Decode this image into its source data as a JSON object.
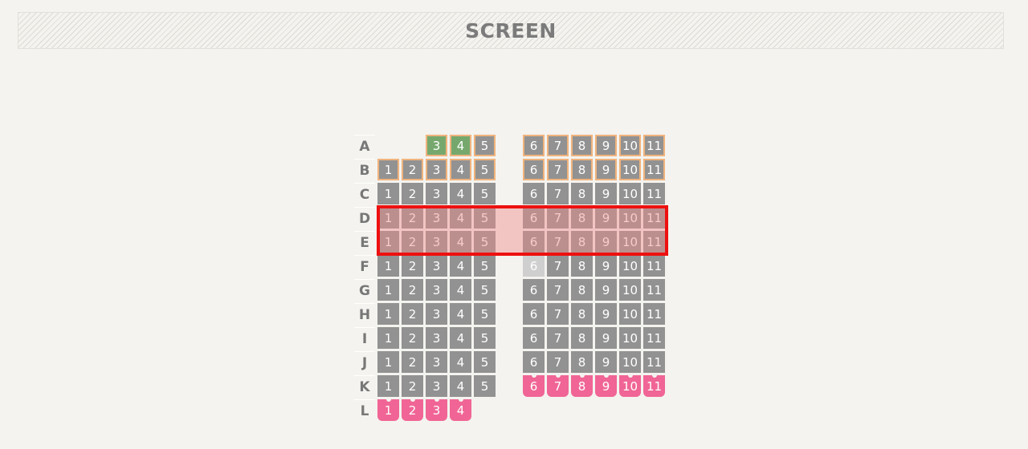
{
  "screen": {
    "label": "SCREEN"
  },
  "rows": [
    {
      "label": "A",
      "seats": [
        {
          "n": "3",
          "state": "green"
        },
        {
          "n": "4",
          "state": "green"
        },
        {
          "n": "5",
          "state": "orange"
        },
        {
          "n": "6",
          "state": "orange"
        },
        {
          "n": "7",
          "state": "orange"
        },
        {
          "n": "8",
          "state": "orange"
        },
        {
          "n": "9",
          "state": "orange"
        },
        {
          "n": "10",
          "state": "orange"
        },
        {
          "n": "11",
          "state": "orange"
        }
      ]
    },
    {
      "label": "B",
      "seats": [
        {
          "n": "1",
          "state": "orange"
        },
        {
          "n": "2",
          "state": "orange"
        },
        {
          "n": "3",
          "state": "orange"
        },
        {
          "n": "4",
          "state": "orange"
        },
        {
          "n": "5",
          "state": "orange"
        },
        {
          "n": "6",
          "state": "orange"
        },
        {
          "n": "7",
          "state": "orange"
        },
        {
          "n": "8",
          "state": "orange"
        },
        {
          "n": "9",
          "state": "orange"
        },
        {
          "n": "10",
          "state": "orange"
        },
        {
          "n": "11",
          "state": "orange"
        }
      ]
    },
    {
      "label": "C",
      "seats": [
        {
          "n": "1",
          "state": "regular"
        },
        {
          "n": "2",
          "state": "regular"
        },
        {
          "n": "3",
          "state": "regular"
        },
        {
          "n": "4",
          "state": "regular"
        },
        {
          "n": "5",
          "state": "regular"
        },
        {
          "n": "6",
          "state": "regular"
        },
        {
          "n": "7",
          "state": "regular"
        },
        {
          "n": "8",
          "state": "regular"
        },
        {
          "n": "9",
          "state": "regular"
        },
        {
          "n": "10",
          "state": "regular"
        },
        {
          "n": "11",
          "state": "regular"
        }
      ]
    },
    {
      "label": "D",
      "seats": [
        {
          "n": "1",
          "state": "regular"
        },
        {
          "n": "2",
          "state": "regular"
        },
        {
          "n": "3",
          "state": "regular"
        },
        {
          "n": "4",
          "state": "regular"
        },
        {
          "n": "5",
          "state": "regular"
        },
        {
          "n": "6",
          "state": "regular"
        },
        {
          "n": "7",
          "state": "regular"
        },
        {
          "n": "8",
          "state": "regular"
        },
        {
          "n": "9",
          "state": "regular"
        },
        {
          "n": "10",
          "state": "regular"
        },
        {
          "n": "11",
          "state": "regular"
        }
      ]
    },
    {
      "label": "E",
      "seats": [
        {
          "n": "1",
          "state": "regular"
        },
        {
          "n": "2",
          "state": "regular"
        },
        {
          "n": "3",
          "state": "regular"
        },
        {
          "n": "4",
          "state": "regular"
        },
        {
          "n": "5",
          "state": "regular"
        },
        {
          "n": "6",
          "state": "regular"
        },
        {
          "n": "7",
          "state": "regular"
        },
        {
          "n": "8",
          "state": "regular"
        },
        {
          "n": "9",
          "state": "regular"
        },
        {
          "n": "10",
          "state": "regular"
        },
        {
          "n": "11",
          "state": "regular"
        }
      ]
    },
    {
      "label": "F",
      "seats": [
        {
          "n": "1",
          "state": "regular"
        },
        {
          "n": "2",
          "state": "regular"
        },
        {
          "n": "3",
          "state": "regular"
        },
        {
          "n": "4",
          "state": "regular"
        },
        {
          "n": "5",
          "state": "regular"
        },
        {
          "n": "6",
          "state": "faded"
        },
        {
          "n": "7",
          "state": "regular"
        },
        {
          "n": "8",
          "state": "regular"
        },
        {
          "n": "9",
          "state": "regular"
        },
        {
          "n": "10",
          "state": "regular"
        },
        {
          "n": "11",
          "state": "regular"
        }
      ]
    },
    {
      "label": "G",
      "seats": [
        {
          "n": "1",
          "state": "regular"
        },
        {
          "n": "2",
          "state": "regular"
        },
        {
          "n": "3",
          "state": "regular"
        },
        {
          "n": "4",
          "state": "regular"
        },
        {
          "n": "5",
          "state": "regular"
        },
        {
          "n": "6",
          "state": "regular"
        },
        {
          "n": "7",
          "state": "regular"
        },
        {
          "n": "8",
          "state": "regular"
        },
        {
          "n": "9",
          "state": "regular"
        },
        {
          "n": "10",
          "state": "regular"
        },
        {
          "n": "11",
          "state": "regular"
        }
      ]
    },
    {
      "label": "H",
      "seats": [
        {
          "n": "1",
          "state": "regular"
        },
        {
          "n": "2",
          "state": "regular"
        },
        {
          "n": "3",
          "state": "regular"
        },
        {
          "n": "4",
          "state": "regular"
        },
        {
          "n": "5",
          "state": "regular"
        },
        {
          "n": "6",
          "state": "regular"
        },
        {
          "n": "7",
          "state": "regular"
        },
        {
          "n": "8",
          "state": "regular"
        },
        {
          "n": "9",
          "state": "regular"
        },
        {
          "n": "10",
          "state": "regular"
        },
        {
          "n": "11",
          "state": "regular"
        }
      ]
    },
    {
      "label": "I",
      "seats": [
        {
          "n": "1",
          "state": "regular"
        },
        {
          "n": "2",
          "state": "regular"
        },
        {
          "n": "3",
          "state": "regular"
        },
        {
          "n": "4",
          "state": "regular"
        },
        {
          "n": "5",
          "state": "regular"
        },
        {
          "n": "6",
          "state": "regular"
        },
        {
          "n": "7",
          "state": "regular"
        },
        {
          "n": "8",
          "state": "regular"
        },
        {
          "n": "9",
          "state": "regular"
        },
        {
          "n": "10",
          "state": "regular"
        },
        {
          "n": "11",
          "state": "regular"
        }
      ]
    },
    {
      "label": "J",
      "seats": [
        {
          "n": "1",
          "state": "regular"
        },
        {
          "n": "2",
          "state": "regular"
        },
        {
          "n": "3",
          "state": "regular"
        },
        {
          "n": "4",
          "state": "regular"
        },
        {
          "n": "5",
          "state": "regular"
        },
        {
          "n": "6",
          "state": "regular"
        },
        {
          "n": "7",
          "state": "regular"
        },
        {
          "n": "8",
          "state": "regular"
        },
        {
          "n": "9",
          "state": "regular"
        },
        {
          "n": "10",
          "state": "regular"
        },
        {
          "n": "11",
          "state": "regular"
        }
      ]
    },
    {
      "label": "K",
      "seats": [
        {
          "n": "1",
          "state": "regular"
        },
        {
          "n": "2",
          "state": "regular"
        },
        {
          "n": "3",
          "state": "regular"
        },
        {
          "n": "4",
          "state": "regular"
        },
        {
          "n": "5",
          "state": "regular"
        },
        {
          "n": "6",
          "state": "pink"
        },
        {
          "n": "7",
          "state": "pink"
        },
        {
          "n": "8",
          "state": "pink"
        },
        {
          "n": "9",
          "state": "pink"
        },
        {
          "n": "10",
          "state": "pink"
        },
        {
          "n": "11",
          "state": "pink"
        }
      ]
    },
    {
      "label": "L",
      "seats": [
        {
          "n": "1",
          "state": "pink"
        },
        {
          "n": "2",
          "state": "pink"
        },
        {
          "n": "3",
          "state": "pink"
        },
        {
          "n": "4",
          "state": "pink"
        }
      ]
    }
  ],
  "colors": {
    "seat_regular": "#929292",
    "seat_green": "#76a86e",
    "seat_pink": "#f06595",
    "seat_outline_orange": "#f0b37d",
    "highlight_border": "#ee1010",
    "background": "#f4f3ef"
  }
}
